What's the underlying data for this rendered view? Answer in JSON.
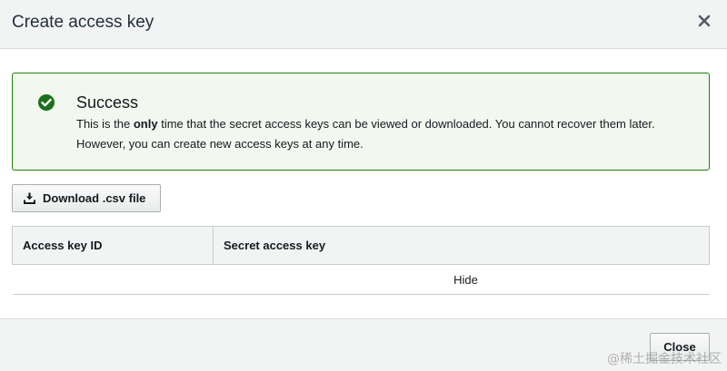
{
  "dialog": {
    "title": "Create access key",
    "close_icon": "close-icon"
  },
  "alert": {
    "status": "success",
    "icon": "check-circle-icon",
    "color": "#1d8102",
    "background": "#f2f8f0",
    "title": "Success",
    "body_before": "This is the ",
    "body_emphasis": "only",
    "body_after": " time that the secret access keys can be viewed or downloaded. You cannot recover them later. However, you can create new access keys at any time."
  },
  "download_button": {
    "icon": "download-icon",
    "label": "Download .csv file"
  },
  "table": {
    "columns": [
      "Access key ID",
      "Secret access key"
    ],
    "rows": [
      {
        "access_key_id": "",
        "secret_access_key": "",
        "toggle_label": "Hide"
      }
    ]
  },
  "footer": {
    "close_label": "Close"
  },
  "watermark": "@稀土掘金技术社区"
}
